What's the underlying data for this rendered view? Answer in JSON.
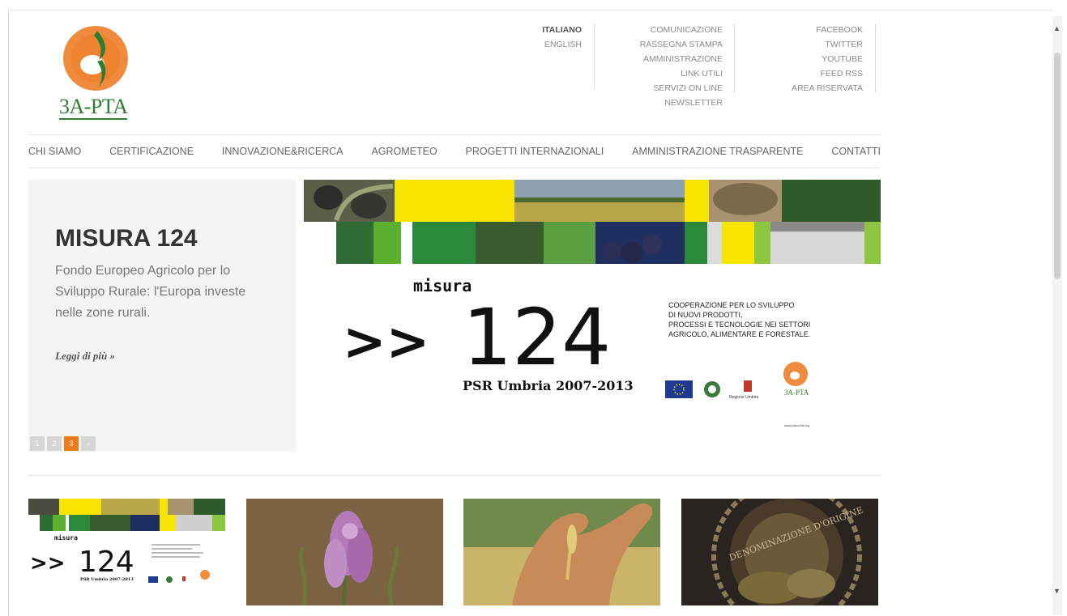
{
  "logo": {
    "text": "3A-PTA"
  },
  "languages": [
    {
      "label": "ITALIANO",
      "active": true
    },
    {
      "label": "ENGLISH",
      "active": false
    }
  ],
  "info_links": [
    "COMUNICAZIONE",
    "RASSEGNA STAMPA",
    "AMMINISTRAZIONE",
    "LINK UTILI",
    "SERVIZI ON LINE",
    "NEWSLETTER"
  ],
  "social_links": [
    "FACEBOOK",
    "TWITTER",
    "YOUTUBE",
    "FEED RSS",
    "AREA RISERVATA"
  ],
  "nav": [
    "CHI SIAMO",
    "CERTIFICAZIONE",
    "INNOVAZIONE&RICERCA",
    "AGROMETEO",
    "PROGETTI INTERNAZIONALI",
    "AMMINISTRAZIONE TRASPARENTE",
    "CONTATTI"
  ],
  "slide": {
    "title": "MISURA 124",
    "description": "Fondo Europeo Agricolo per lo Sviluppo Rurale: l'Europa investe nelle zone rurali.",
    "read_more": "Leggi di più »",
    "pager": [
      "1",
      "2",
      "3",
      "›"
    ],
    "active_page": 3
  },
  "banner": {
    "misura": "misura",
    "arrows": ">>",
    "number": "124",
    "subtitle": "PSR Umbria 2007-2013",
    "caption": [
      "COOPERAZIONE PER LO SVILUPPO",
      "DI NUOVI PRODOTTI,",
      "PROCESSI E TECNOLOGIE NEI SETTORI",
      "AGRICOLO, ALIMENTARE E FORESTALE."
    ],
    "partner_logo_text": "3A-PTA",
    "region_text": "Regione Umbria",
    "website": "www.parco3a.org"
  },
  "thumb1": {
    "misura": "misura",
    "arrows": ">>",
    "number": "124",
    "subtitle": "PSR Umbria 2007-2013"
  },
  "thumb4": {
    "seal_text": "DENOMINAZIONE D'ORIGINE"
  },
  "colors": {
    "accent": "#f07b18",
    "green": "#2e7d32",
    "yellow": "#f7e400",
    "dark_green": "#2f6b35"
  }
}
